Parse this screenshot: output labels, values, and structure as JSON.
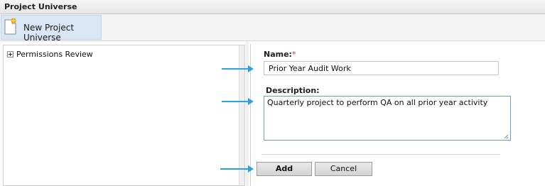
{
  "window": {
    "title": "Project Universe"
  },
  "toolbar": {
    "new_button_label": "New Project Universe",
    "new_button_icon": "new-document-icon"
  },
  "tree": {
    "items": [
      {
        "label": "Permissions Review",
        "expander_icon": "expand-plus-icon"
      }
    ]
  },
  "form": {
    "name_label": "Name:",
    "required_marker": "*",
    "name_value": "Prior Year Audit Work",
    "description_label": "Description:",
    "description_value": "Quarterly project to perform QA on all prior year activity",
    "add_label": "Add",
    "cancel_label": "Cancel"
  },
  "annotations": {
    "arrow_color": "#2aa3e0",
    "arrow_count": 3
  },
  "colors": {
    "selected_toolbar_bg": "#d9e6f5",
    "required": "#d0352a",
    "focus_border": "#6f9ed6"
  }
}
